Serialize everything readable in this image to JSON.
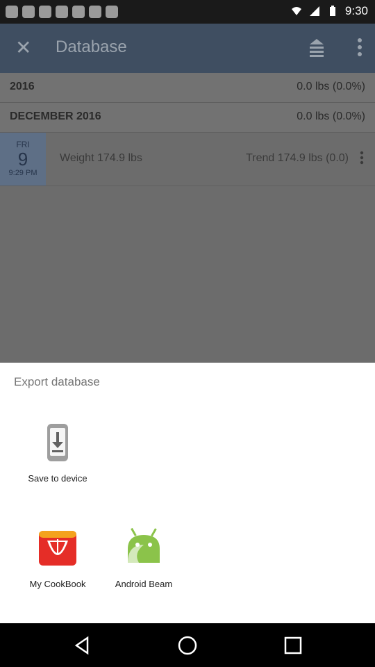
{
  "status": {
    "time": "9:30"
  },
  "appbar": {
    "title": "Database"
  },
  "list": {
    "year_header": {
      "label": "2016",
      "value": "0.0 lbs (0.0%)"
    },
    "month_header": {
      "label": "DECEMBER 2016",
      "value": "0.0 lbs (0.0%)"
    },
    "entry": {
      "day_of_week": "FRI",
      "day": "9",
      "time": "9:29 PM",
      "weight": "Weight 174.9 lbs",
      "trend": "Trend 174.9 lbs (0.0)"
    }
  },
  "sheet": {
    "title": "Export database",
    "items": [
      {
        "label": "Save to device",
        "icon": "phone-download-icon"
      },
      {
        "label": "My CookBook",
        "icon": "cookbook-icon"
      },
      {
        "label": "Android Beam",
        "icon": "android-beam-icon"
      }
    ]
  },
  "colors": {
    "appbar": "#3f4e61",
    "daybox": "#5e6f86",
    "cookbook_red": "#e52d27",
    "android_green": "#8bc34a"
  }
}
